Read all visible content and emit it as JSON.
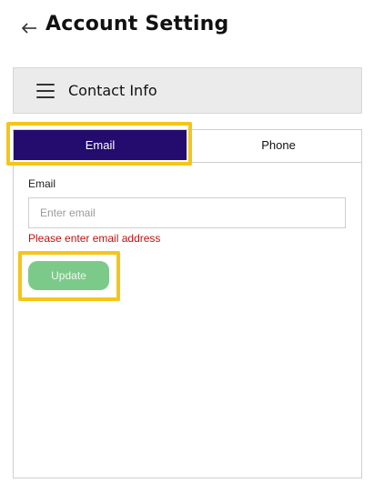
{
  "header": {
    "title": "Account Setting",
    "back_icon": "arrow-left-icon"
  },
  "section": {
    "title": "Contact Info",
    "menu_icon": "hamburger-menu-icon"
  },
  "tabs": [
    {
      "label": "Email",
      "active": true
    },
    {
      "label": "Phone",
      "active": false
    }
  ],
  "form": {
    "email_label": "Email",
    "email_value": "",
    "email_placeholder": "Enter email",
    "error": "Please enter email address",
    "submit_label": "Update"
  },
  "colors": {
    "active_tab": "#230c6e",
    "error": "#c41010",
    "button": "#7cca89",
    "highlight": "#f5c518"
  }
}
